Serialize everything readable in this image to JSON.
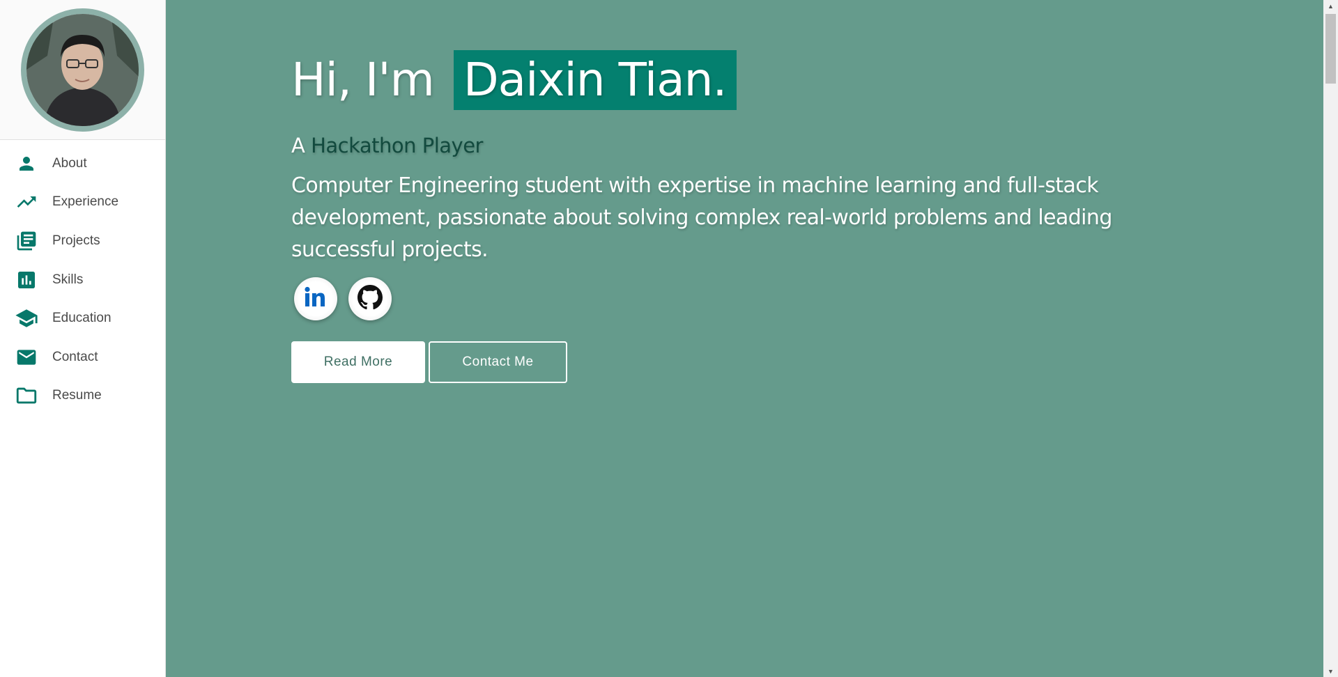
{
  "sidebar": {
    "items": [
      {
        "label": "About",
        "icon": "person-icon"
      },
      {
        "label": "Experience",
        "icon": "trending-up-icon"
      },
      {
        "label": "Projects",
        "icon": "library-books-icon"
      },
      {
        "label": "Skills",
        "icon": "bar-chart-icon"
      },
      {
        "label": "Education",
        "icon": "school-icon"
      },
      {
        "label": "Contact",
        "icon": "mail-icon"
      },
      {
        "label": "Resume",
        "icon": "folder-icon"
      }
    ]
  },
  "hero": {
    "greeting": "Hi, I'm",
    "name": "Daixin Tian.",
    "role_prefix": "A",
    "role": "Hackathon Player",
    "description": "Computer Engineering student with expertise in machine learning and full-stack development, passionate about solving complex real-world problems and leading successful projects.",
    "read_more_label": "Read More",
    "contact_label": "Contact Me"
  },
  "social": {
    "linkedin_icon": "linkedin-icon",
    "github_icon": "github-icon"
  },
  "colors": {
    "accent": "#04806f",
    "hero_background": "#659b8c",
    "icon_color": "#07786a",
    "role_highlight": "#124a3e"
  }
}
